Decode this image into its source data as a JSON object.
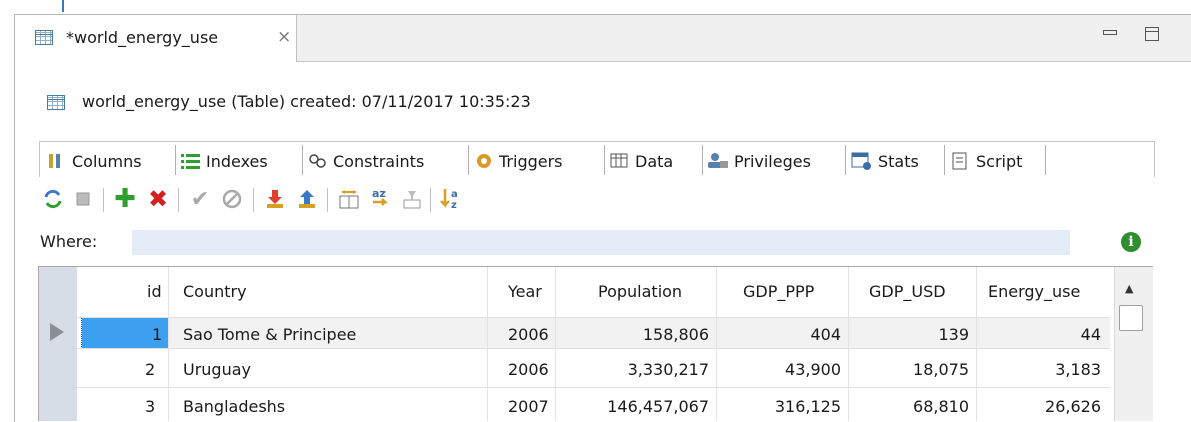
{
  "editor_tab": {
    "title": "*world_energy_use",
    "close_glyph": "×"
  },
  "header": {
    "text": "world_energy_use (Table) created: 07/11/2017 10:35:23"
  },
  "subtabs": [
    {
      "label": "Columns",
      "icon": "columns-icon"
    },
    {
      "label": "Indexes",
      "icon": "indexes-icon"
    },
    {
      "label": "Constraints",
      "icon": "constraints-icon"
    },
    {
      "label": "Triggers",
      "icon": "triggers-icon"
    },
    {
      "label": "Data",
      "icon": "data-icon"
    },
    {
      "label": "Privileges",
      "icon": "privileges-icon"
    },
    {
      "label": "Stats",
      "icon": "stats-icon"
    },
    {
      "label": "Script",
      "icon": "script-icon"
    }
  ],
  "where": {
    "label": "Where:",
    "value": ""
  },
  "table": {
    "columns": [
      "id",
      "Country",
      "Year",
      "Population",
      "GDP_PPP",
      "GDP_USD",
      "Energy_use"
    ],
    "rows": [
      [
        "1",
        "Sao Tome & Principee",
        "2006",
        "158,806",
        "404",
        "139",
        "44"
      ],
      [
        "2",
        "Uruguay",
        "2006",
        "3,330,217",
        "43,900",
        "18,075",
        "3,183"
      ],
      [
        "3",
        "Bangladeshs",
        "2007",
        "146,457,067",
        "316,125",
        "68,810",
        "26,626"
      ]
    ]
  },
  "colors": {
    "accent": "#3a78c8",
    "selection": "#3d9ff0",
    "where_bg": "#e4ecf7",
    "info": "#2f8e2f",
    "add": "#2e9e2e",
    "delete": "#d42020"
  }
}
